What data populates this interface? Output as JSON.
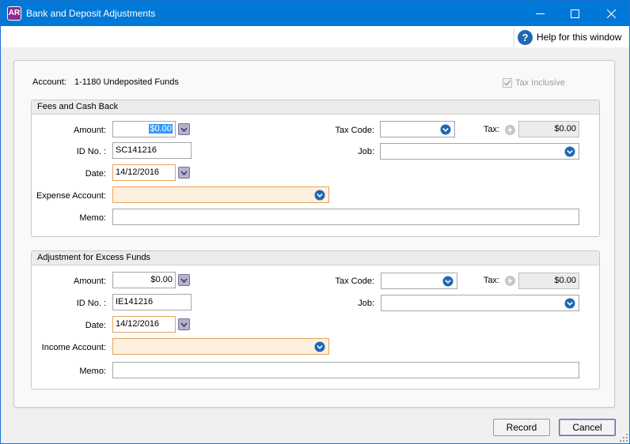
{
  "window": {
    "title": "Bank and Deposit Adjustments",
    "app_badge": "AR",
    "help_label": "Help for this window"
  },
  "header": {
    "account_label": "Account:",
    "account_value": "1-1180 Undeposited Funds",
    "tax_inclusive_label": "Tax Inclusive",
    "tax_inclusive_checked": true
  },
  "fees": {
    "title": "Fees and Cash Back",
    "amount_label": "Amount:",
    "amount_value": "$0.00",
    "id_label": "ID No. :",
    "id_value": "SC141216",
    "date_label": "Date:",
    "date_value": "14/12/2016",
    "account_label": "Expense Account:",
    "account_value": "",
    "memo_label": "Memo:",
    "memo_value": "",
    "tax_code_label": "Tax Code:",
    "tax_code_value": "",
    "tax_label": "Tax:",
    "tax_value": "$0.00",
    "job_label": "Job:",
    "job_value": ""
  },
  "excess": {
    "title": "Adjustment for Excess Funds",
    "amount_label": "Amount:",
    "amount_value": "$0.00",
    "id_label": "ID No. :",
    "id_value": "IE141216",
    "date_label": "Date:",
    "date_value": "14/12/2016",
    "account_label": "Income Account:",
    "account_value": "",
    "memo_label": "Memo:",
    "memo_value": "",
    "tax_code_label": "Tax Code:",
    "tax_code_value": "",
    "tax_label": "Tax:",
    "tax_value": "$0.00",
    "job_label": "Job:",
    "job_value": ""
  },
  "buttons": {
    "record": "Record",
    "cancel": "Cancel"
  },
  "colors": {
    "titlebar": "#0078d7",
    "required_fill": "#fdf0df",
    "required_border": "#e8a45a",
    "combo_icon": "#1f69b2"
  },
  "icons": {
    "app": "ar-app-icon",
    "help": "help-circle-icon",
    "combo": "chevron-down-circle-icon",
    "calculator": "chevron-down-icon",
    "tax_detail": "arrow-right-circle-icon"
  }
}
